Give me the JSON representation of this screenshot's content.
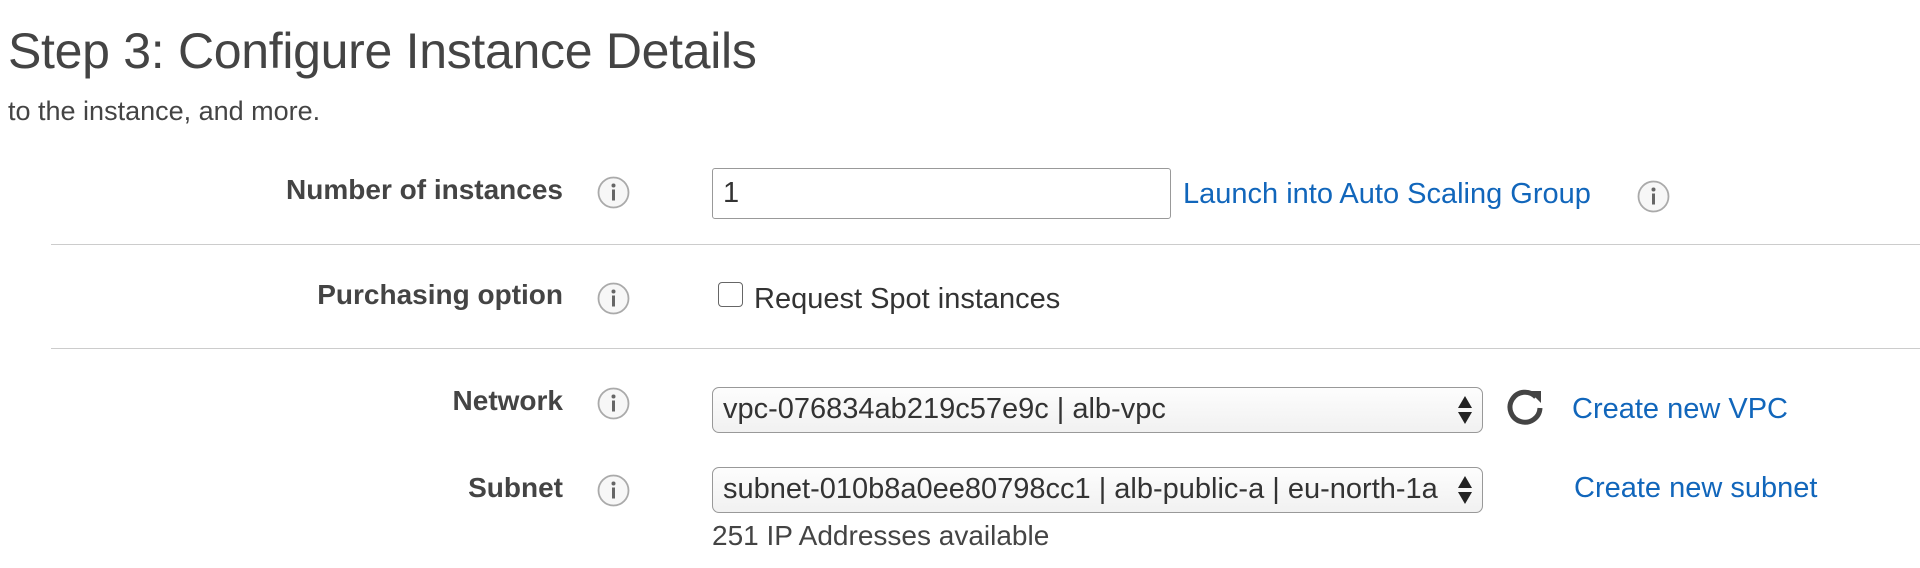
{
  "header": {
    "title": "Step 3: Configure Instance Details",
    "subtitle": "to the instance, and more."
  },
  "form": {
    "number_of_instances": {
      "label": "Number of instances",
      "value": "1",
      "asg_link": "Launch into Auto Scaling Group"
    },
    "purchasing_option": {
      "label": "Purchasing option",
      "checkbox_label": "Request Spot instances",
      "checked": false
    },
    "network": {
      "label": "Network",
      "selected": "vpc-076834ab219c57e9c | alb-vpc",
      "create_link": "Create new VPC"
    },
    "subnet": {
      "label": "Subnet",
      "selected": "subnet-010b8a0ee80798cc1 | alb-public-a | eu-north-1a",
      "create_link": "Create new subnet",
      "helper": "251 IP Addresses available"
    }
  },
  "icons": {
    "info": "info-icon",
    "refresh": "refresh-icon",
    "select_arrows": "select-arrows-icon"
  },
  "colors": {
    "link": "#1166bb",
    "text": "#444444",
    "divider": "#cccccc"
  }
}
